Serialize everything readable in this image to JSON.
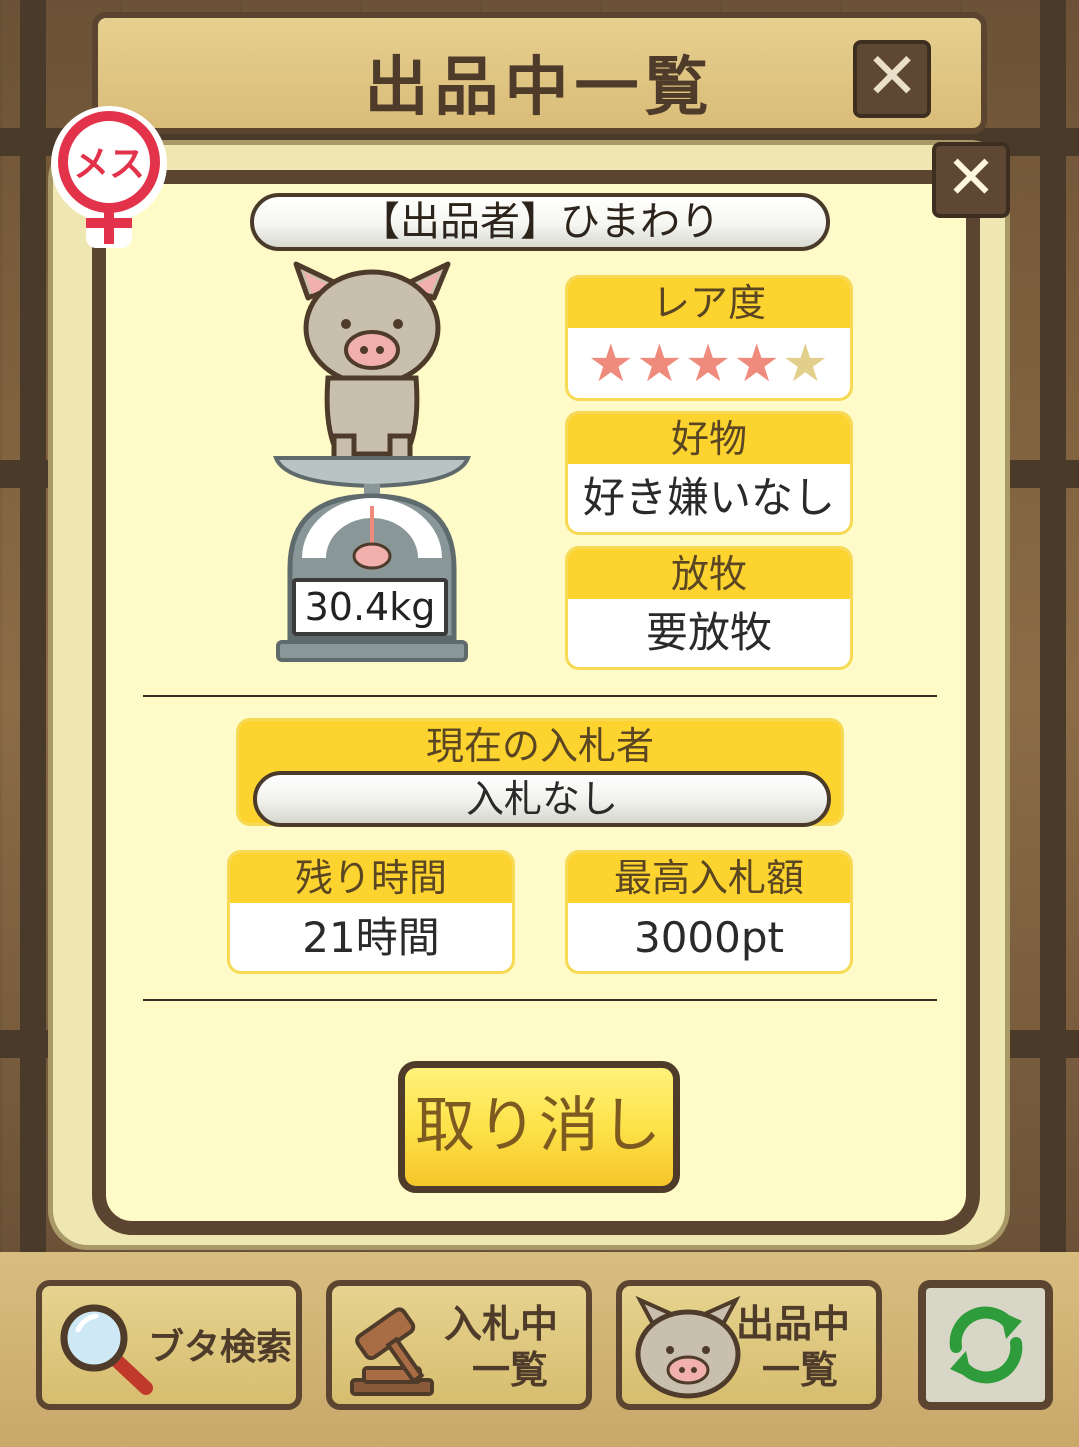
{
  "header": {
    "title": "出品中一覧",
    "close_label": "✕"
  },
  "dialog": {
    "close_label": "✕",
    "gender_badge": "メス",
    "seller": "【出品者】ひまわり",
    "weight": "30.4kg",
    "rarity": {
      "label": "レア度",
      "stars_filled": 4,
      "stars_total": 5,
      "filled_color": "#ef8b7d",
      "empty_color": "#e3cf8c"
    },
    "favorite": {
      "label": "好物",
      "value": "好き嫌いなし"
    },
    "grazing": {
      "label": "放牧",
      "value": "要放牧"
    },
    "bidder": {
      "label": "現在の入札者",
      "value": "入札なし"
    },
    "remaining": {
      "label": "残り時間",
      "value": "21時間"
    },
    "max_bid": {
      "label": "最高入札額",
      "value": "3000pt"
    },
    "cancel_label": "取り消し"
  },
  "bottom_nav": {
    "search_label": "ブタ検索",
    "bidding_line1": "入札中",
    "bidding_line2": "一覧",
    "listing_line1": "出品中",
    "listing_line2": "一覧"
  },
  "colors": {
    "accent_yellow": "#fcd32f",
    "frame_brown": "#5b4530",
    "panel_cream": "#fffbc8",
    "female_red": "#e2334a"
  }
}
